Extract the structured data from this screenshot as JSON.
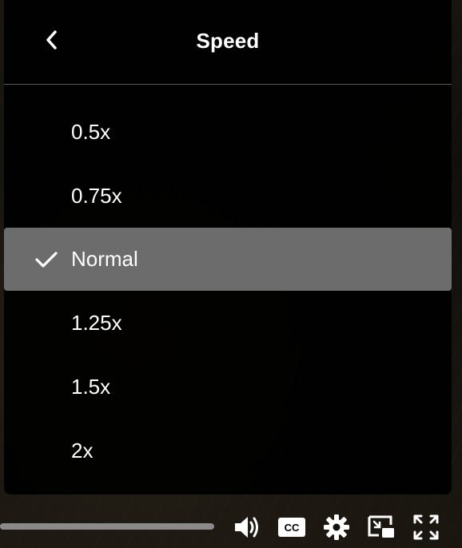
{
  "menu": {
    "title": "Speed",
    "options": [
      {
        "label": "0.5x",
        "selected": false
      },
      {
        "label": "0.75x",
        "selected": false
      },
      {
        "label": "Normal",
        "selected": true
      },
      {
        "label": "1.25x",
        "selected": false
      },
      {
        "label": "1.5x",
        "selected": false
      },
      {
        "label": "2x",
        "selected": false
      }
    ]
  },
  "controls": {
    "icons": [
      "volume-icon",
      "captions-icon",
      "settings-icon",
      "picture-in-picture-icon",
      "fullscreen-icon"
    ],
    "captions_label": "CC"
  },
  "colors": {
    "menu_bg": "#000000",
    "selected_bg": "#6c6c6c",
    "text": "#ffffff",
    "divider": "#5a5a5a",
    "progress_track": "#8a8a8a"
  }
}
